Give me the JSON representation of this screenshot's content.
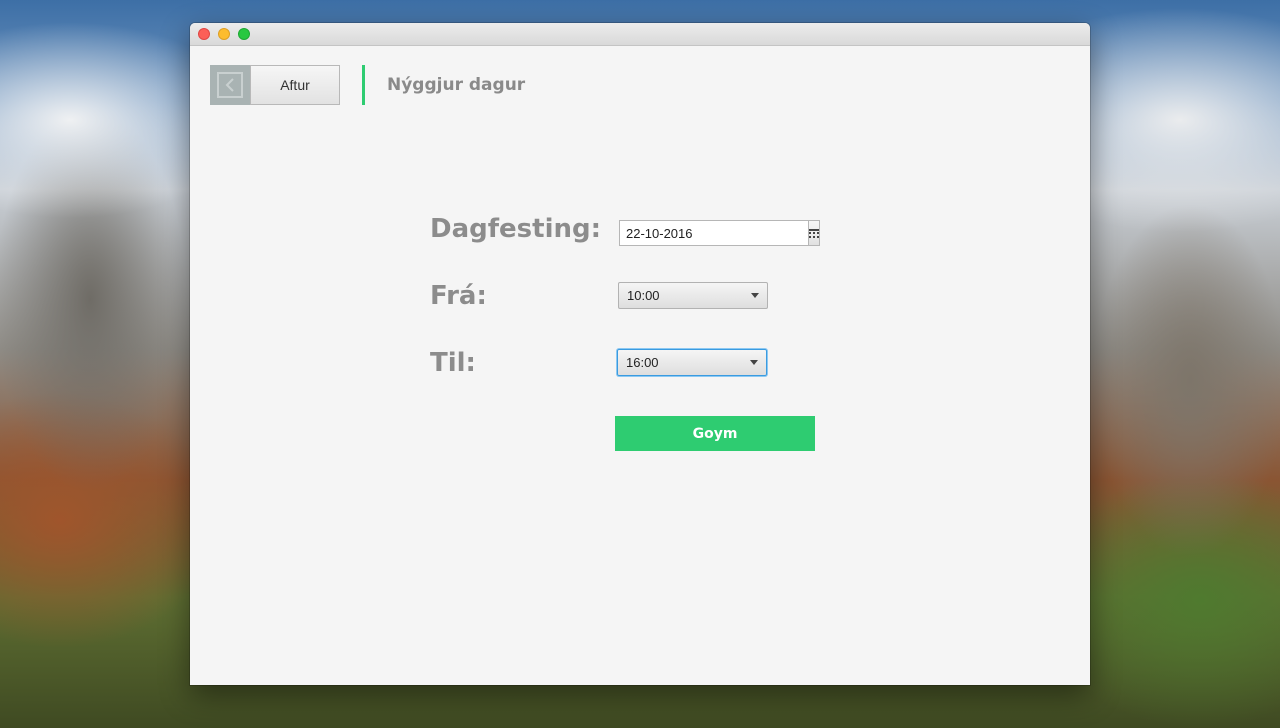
{
  "window": {
    "controls": [
      "close",
      "minimize",
      "maximize"
    ]
  },
  "header": {
    "back_label": "Aftur",
    "back_icon": "chevron-left-icon",
    "title": "Nýggjur dagur",
    "accent_color": "#2ecc71"
  },
  "form": {
    "date_label": "Dagfesting:",
    "date_value": "22-10-2016",
    "calendar_icon": "calendar-icon",
    "from_label": "Frá:",
    "from_value": "10:00",
    "to_label": "Til:",
    "to_value": "16:00",
    "save_label": "Goym",
    "save_color": "#2ecc71"
  }
}
